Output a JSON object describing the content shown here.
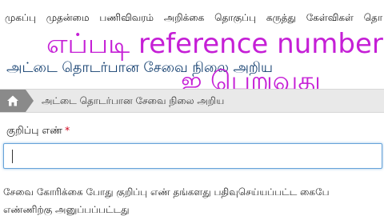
{
  "nav": {
    "items": [
      "முகப்பு",
      "முதன்மை",
      "பணிவிவரம்",
      "அறிக்கை",
      "தொகுப்பு",
      "கருத்து",
      "கேள்விகள்",
      "தொ"
    ]
  },
  "page": {
    "heading": "அட்டை தொடர்பான சேவை நிலை அறிய"
  },
  "overlay": {
    "line1": "எப்படி reference number",
    "line2": "ஐ பெறுவது",
    "color": "#c51fd6"
  },
  "breadcrumb": {
    "home_icon": "home-icon",
    "current": "அட்டை தொடர்பான சேவை நிலை அறிய"
  },
  "form": {
    "reference_label": "குறிப்பு எண்",
    "required_mark": "*",
    "reference_value": ""
  },
  "help": {
    "line1": "சேவை கோரிக்கை போது குறிப்பு எண் தங்களது பதிவுசெய்யப்பட்ட கைபே",
    "line2": "எண்ணிற்கு அனுப்பப்பட்டது"
  }
}
